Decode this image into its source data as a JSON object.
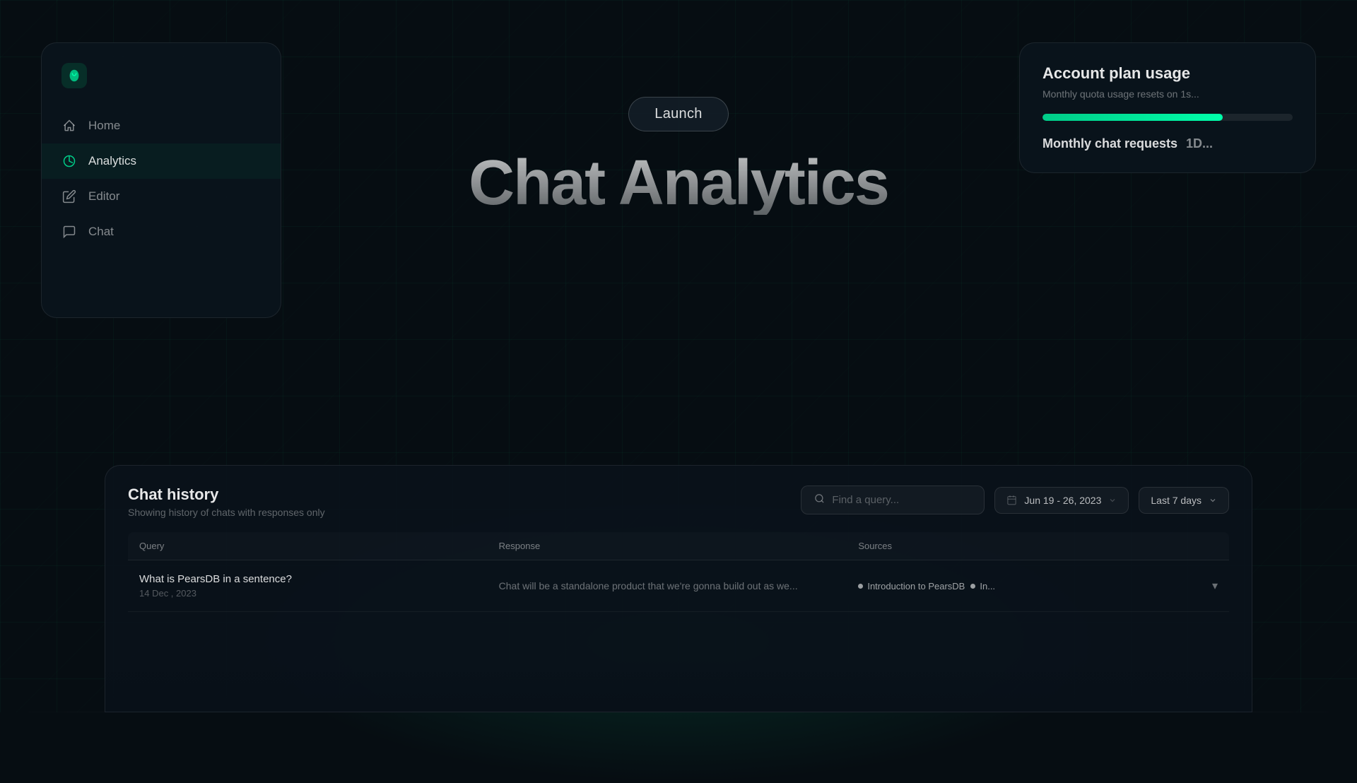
{
  "app": {
    "title": "Chat Analytics"
  },
  "sidebar": {
    "logo_alt": "PearsDB logo",
    "nav_items": [
      {
        "id": "home",
        "label": "Home",
        "active": false
      },
      {
        "id": "analytics",
        "label": "Analytics",
        "active": true
      },
      {
        "id": "editor",
        "label": "Editor",
        "active": false
      },
      {
        "id": "chat",
        "label": "Chat",
        "active": false
      }
    ]
  },
  "hero": {
    "launch_label": "Launch",
    "title": "Chat Analytics"
  },
  "account_card": {
    "title": "Account plan usage",
    "subtitle": "Monthly quota usage resets on 1s...",
    "progress_percent": 72,
    "monthly_chat_label": "Monthly chat requests",
    "monthly_chat_value": "1D..."
  },
  "chat_history": {
    "title": "Chat history",
    "subtitle": "Showing history of chats with responses only",
    "search_placeholder": "Find a query...",
    "date_range": "Jun 19 - 26, 2023",
    "period": "Last 7 days",
    "columns": [
      "Query",
      "Response",
      "Sources"
    ],
    "rows": [
      {
        "query": "What is PearsDB in a sentence?",
        "date": "14 Dec , 2023",
        "response": "Chat will be a standalone product that we're gonna build out as we...",
        "sources": [
          "Introduction to PearsDB",
          "In..."
        ]
      }
    ]
  },
  "icons": {
    "home": "⌂",
    "analytics": "◑",
    "editor": "✎",
    "chat": "💬",
    "search": "🔍",
    "calendar": "📅",
    "chevron_down": "▾"
  }
}
